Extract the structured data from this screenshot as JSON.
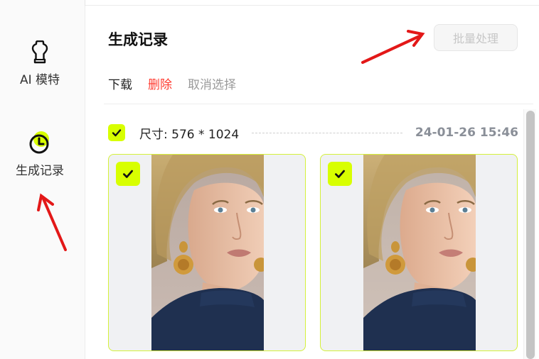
{
  "sidebar": {
    "items": [
      {
        "label": "AI 模特",
        "icon": "mannequin-icon",
        "active": false
      },
      {
        "label": "生成记录",
        "icon": "clock-icon",
        "active": true
      }
    ]
  },
  "header": {
    "title": "生成记录",
    "batch_button": "批量处理"
  },
  "actions": {
    "download": "下载",
    "delete": "删除",
    "cancel_selection": "取消选择"
  },
  "group": {
    "size_label": "尺寸: 576 * 1024",
    "timestamp": "24-01-26 15:46",
    "selected": true,
    "images": [
      {
        "selected": true
      },
      {
        "selected": true
      }
    ]
  },
  "colors": {
    "accent": "#d8ff00",
    "delete": "#ff3b30",
    "annotation_arrow": "#e31818"
  }
}
